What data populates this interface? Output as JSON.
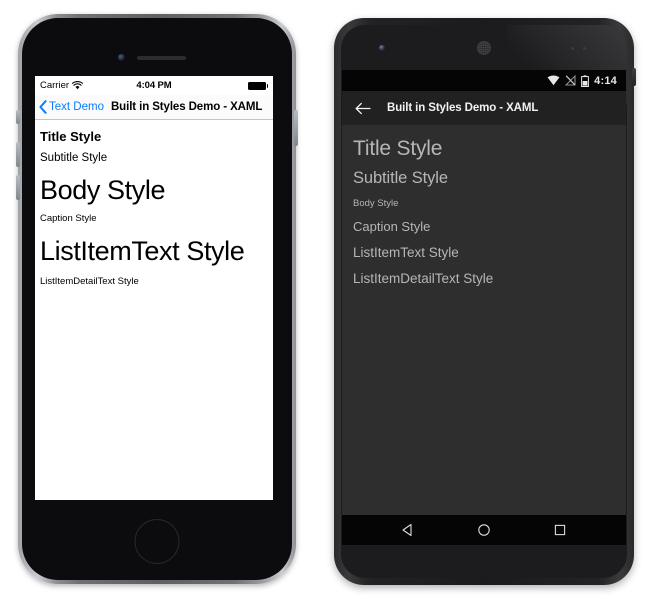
{
  "ios": {
    "status": {
      "carrier": "Carrier",
      "wifi_icon": "wifi-icon",
      "time": "4:04 PM",
      "battery_icon": "battery-full-icon"
    },
    "nav": {
      "back_chevron_icon": "chevron-left-icon",
      "back_label": "Text Demo",
      "title": "Built in Styles Demo - XAML"
    },
    "content": {
      "lines": [
        {
          "key": "title",
          "text": "Title Style"
        },
        {
          "key": "subtitle",
          "text": "Subtitle Style"
        },
        {
          "key": "body",
          "text": "Body Style"
        },
        {
          "key": "caption",
          "text": "Caption Style"
        },
        {
          "key": "listitem",
          "text": "ListItemText Style"
        },
        {
          "key": "listdetail",
          "text": "ListItemDetailText Style"
        }
      ]
    },
    "hardware": {
      "camera": "front-camera",
      "speaker": "earpiece-speaker",
      "home_button": "home-button",
      "mute_switch": "mute-switch",
      "volume_up": "volume-up-button",
      "volume_down": "volume-down-button",
      "power": "power-button"
    },
    "colors": {
      "accent": "#0a7cff",
      "nav_bg": "#fbfbfb",
      "screen_bg": "#ffffff",
      "text": "#000000"
    }
  },
  "android": {
    "status": {
      "wifi_icon": "wifi-icon",
      "signal_icon": "signal-no-sim-icon",
      "battery_icon": "battery-half-icon",
      "time": "4:14"
    },
    "appbar": {
      "back_icon": "arrow-left-icon",
      "title": "Built in Styles Demo - XAML"
    },
    "content": {
      "lines": [
        {
          "key": "title",
          "text": "Title Style"
        },
        {
          "key": "subtitle",
          "text": "Subtitle Style"
        },
        {
          "key": "body",
          "text": "Body Style"
        },
        {
          "key": "caption",
          "text": "Caption Style"
        },
        {
          "key": "listitem",
          "text": "ListItemText Style"
        },
        {
          "key": "listdetail",
          "text": "ListItemDetailText Style"
        }
      ]
    },
    "navbar": {
      "back_icon": "nav-back-triangle-icon",
      "home_icon": "nav-home-circle-icon",
      "recents_icon": "nav-recents-square-icon"
    },
    "hardware": {
      "camera": "front-camera",
      "speaker": "earpiece-grille",
      "sensors": "proximity-sensors",
      "power": "power-button"
    },
    "colors": {
      "screen_bg": "#2e2e2e",
      "appbar_bg": "#212121",
      "status_bg": "#050505",
      "text": "#b6b6b6",
      "appbar_text": "#f2f2f2"
    }
  }
}
